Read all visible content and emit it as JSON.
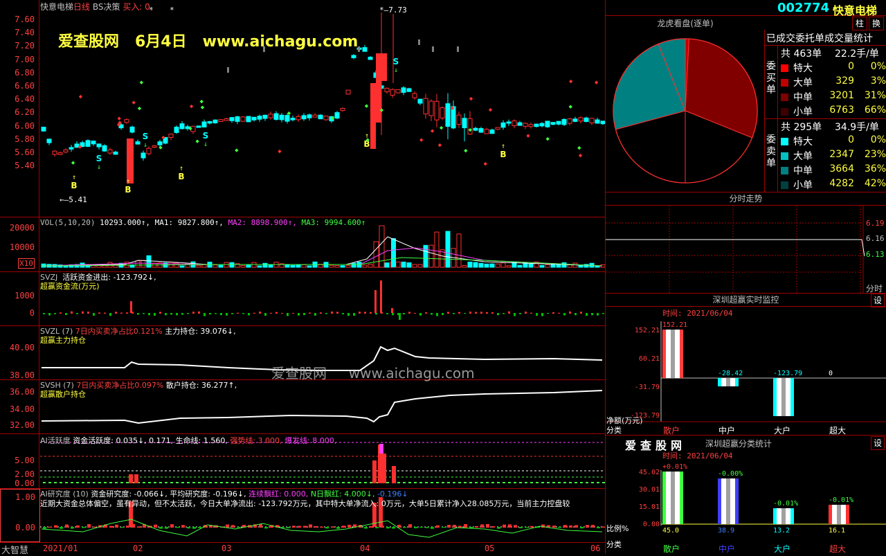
{
  "header": {
    "stock_name": "快意电梯",
    "period": "日线",
    "indicator": "BS决策",
    "buy_label": "买入: 0,",
    "peak_label": "7.73",
    "low_label": "5.41",
    "watermark_top": "爱查股网   6月4日   www.aichagu.com",
    "watermark_mid": "爱查股网     www.aichagu.com"
  },
  "main_y_labels": [
    "7.60",
    "7.40",
    "7.20",
    "7.00",
    "6.80",
    "6.60",
    "6.40",
    "6.20",
    "6.00",
    "5.80",
    "5.60",
    "5.40"
  ],
  "signals": {
    "buy": "B",
    "sell": "S"
  },
  "vol": {
    "header_left": "VOL(5,10,20)",
    "value": "10293.000↑,",
    "ma1": "MA1: 9827.800↑,",
    "ma2": "MA2: 8898.900↑,",
    "ma3": "MA3: 9994.600↑",
    "y_labels": [
      "20000",
      "10000"
    ],
    "unit": "X10"
  },
  "svzj": {
    "title": "SVZJ",
    "line1": "活跃资金进出: -123.792↓,",
    "line2": "超赢资金流(万元)",
    "y_labels": [
      "1000",
      "0"
    ]
  },
  "svzl": {
    "title": "SVZL  (7)",
    "line1a": "7日内买卖净占比0.121%",
    "line1b": "主力持仓: 39.076↓,",
    "line2": "超赢主力持仓",
    "y_labels": [
      "40.00",
      "38.00"
    ]
  },
  "svsh": {
    "title": "SVSH  (7)",
    "line1a": "7日内买卖净占比0.097%",
    "line1b": "散户持仓: 36.277↑,",
    "line2": "超赢散户持仓",
    "y_labels": [
      "36.00",
      "34.00",
      "32.00"
    ]
  },
  "ai_active": {
    "title": "AI活跃度",
    "text1": "资金活跃度: 0.035↓, 0.171, 生命线: 1.560,",
    "text2": "强势线: 3.000,",
    "text3": "爆发线: 8.000,",
    "y_labels": [
      "5.00",
      "2.00",
      "0.00"
    ]
  },
  "ai_research": {
    "title": "AI研究度 (10)",
    "text1": "资金研究度: -0.066↓, 平均研究度: -0.196↓,",
    "text2": "连续飘红: 0.000,",
    "text3": "N日飘红: 4.000↓,",
    "text4": "-0.196↓",
    "comment": "近期大资金总体偏空，虽有异动，但不太活跃，今日大单净流出: -123.792万元，其中特大单净流入: 0万元，大单5日累计净入28.085万元，当前主力控盘较",
    "y_labels": [
      "1.00",
      "0.00"
    ]
  },
  "x_axis": {
    "labels": [
      "2021/01",
      "02",
      "03",
      "04",
      "05",
      "06"
    ],
    "corner": "大智慧"
  },
  "right": {
    "code": "002774",
    "name": "快意电梯",
    "btn_zhu": "柱",
    "btn_huan": "换",
    "lhb_title": "龙虎看盘(逐单)",
    "stat_title": "已成交委托单成交量统计",
    "buy_side": {
      "label": "委买单",
      "summary_a": "共 463单",
      "summary_b": "22.2手/单",
      "rows": [
        {
          "name": "特大",
          "value": "0",
          "pct": "0%",
          "color": "#ff0000"
        },
        {
          "name": "大单",
          "value": "329",
          "pct": "3%",
          "color": "#c00000"
        },
        {
          "name": "中单",
          "value": "3201",
          "pct": "31%",
          "color": "#800000"
        },
        {
          "name": "小单",
          "value": "6763",
          "pct": "66%",
          "color": "#400000"
        }
      ]
    },
    "sell_side": {
      "label": "委卖单",
      "summary_a": "共 295单",
      "summary_b": "34.9手/单",
      "rows": [
        {
          "name": "特大",
          "value": "0",
          "pct": "0%",
          "color": "#00ffff"
        },
        {
          "name": "大单",
          "value": "2347",
          "pct": "23%",
          "color": "#00c0c0"
        },
        {
          "name": "中单",
          "value": "3664",
          "pct": "36%",
          "color": "#008080"
        },
        {
          "name": "小单",
          "value": "4282",
          "pct": "42%",
          "color": "#004040"
        }
      ]
    },
    "fenshi": {
      "title": "分时走势",
      "labels": [
        "6.19",
        "6.16",
        "6.13"
      ],
      "footer": "分时"
    },
    "monitor": {
      "title": "深圳超赢实时监控",
      "set": "设",
      "time": "时间: 2021/06/04",
      "y_labels": [
        "152.21",
        "60.21",
        "-31.79",
        "-123.79"
      ],
      "values": [
        "152.21",
        "-28.42",
        "-123.79",
        "0"
      ],
      "ylabel": "净额(万元)",
      "cat_label": "分类",
      "categories": [
        "散户",
        "中户",
        "大户",
        "超大"
      ]
    },
    "classify": {
      "watermark": "爱查股网",
      "title": "深圳超赢分类统计",
      "set": "设",
      "time": "时间: 2021/06/04",
      "y_labels": [
        "45.02",
        "30.01",
        "15.01",
        "0.00"
      ],
      "changes": [
        "+0.01%",
        "-0.00%",
        "-0.01%",
        "-0.01%"
      ],
      "values": [
        "45.0",
        "38.9",
        "13.2",
        "16.1"
      ],
      "ylabel": "比例%",
      "cat_label": "分类",
      "categories": [
        "散户",
        "中户",
        "大户",
        "超大"
      ]
    }
  }
}
